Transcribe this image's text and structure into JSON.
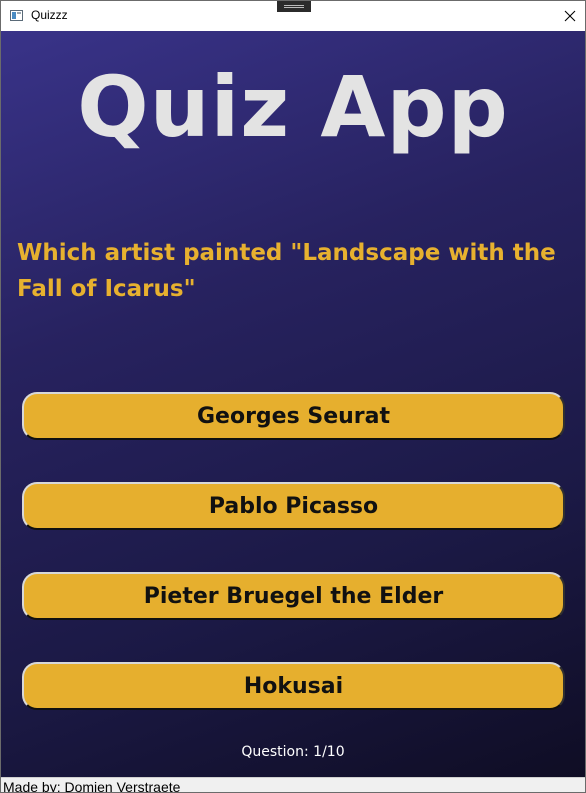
{
  "window": {
    "title": "Quizzz",
    "icon": "app-window-icon",
    "close_icon": "close-icon"
  },
  "header": {
    "title": "Quiz App"
  },
  "question": {
    "text": "Which artist painted \"Landscape with the Fall of Icarus\""
  },
  "answers": [
    {
      "label": "Georges Seurat"
    },
    {
      "label": "Pablo Picasso"
    },
    {
      "label": "Pieter Bruegel the Elder"
    },
    {
      "label": "Hokusai"
    }
  ],
  "progress": {
    "label": "Question: 1/10",
    "current": 1,
    "total": 10
  },
  "footer": {
    "credit": "Made by: Domien Verstraete"
  },
  "colors": {
    "background_top": "#393389",
    "background_bottom": "#0f0d24",
    "accent": "#e6af2e",
    "title_text": "#e3e3e3",
    "question_text": "#e7b12f"
  }
}
